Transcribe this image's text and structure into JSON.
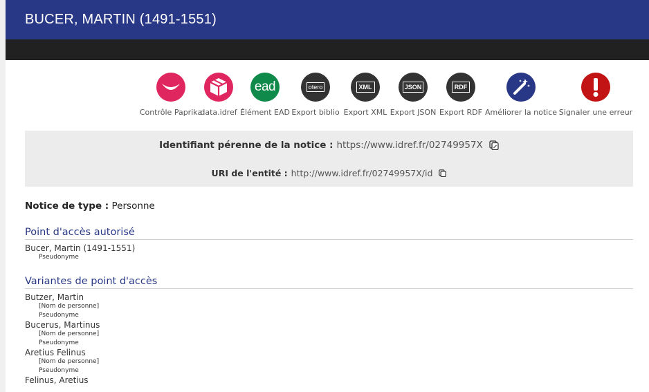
{
  "header": {
    "title": "BUCER, MARTIN (1491-1551)"
  },
  "colors": {
    "header_blue": "#293886",
    "dark_bar": "#212121",
    "section_blue": "#293886",
    "id_box_bg": "#ececec"
  },
  "actions": [
    {
      "label": "Contrôle Paprika",
      "icon": "paprika-icon",
      "color": "#e0265f"
    },
    {
      "label": "data.idref",
      "icon": "cube-icon",
      "color": "#e0265f"
    },
    {
      "label": "Élément EAD",
      "icon": "ead-icon",
      "color": "#0f8a4b",
      "icon_text": "ead"
    },
    {
      "label": "Export biblio",
      "icon": "zotero-icon",
      "color": "#333333",
      "icon_text": "otero"
    },
    {
      "label": "Export XML",
      "icon": "xml-export-icon",
      "color": "#333333",
      "icon_text": "XML"
    },
    {
      "label": "Export JSON",
      "icon": "json-export-icon",
      "color": "#333333",
      "icon_text": "JSON"
    },
    {
      "label": "Export RDF",
      "icon": "rdf-export-icon",
      "color": "#333333",
      "icon_text": "RDF"
    },
    {
      "label": "Améliorer la notice",
      "icon": "magic-wand-icon",
      "color": "#293886"
    },
    {
      "label": "Signaler une erreur",
      "icon": "alert-icon",
      "color": "#c21414"
    }
  ],
  "identifiers": {
    "perenne_label": "Identifiant pérenne de la notice :",
    "perenne_value": "https://www.idref.fr/02749957X",
    "uri_label": "URI de l'entité :",
    "uri_value": "http://www.idref.fr/02749957X/id"
  },
  "notice": {
    "type_label": "Notice de type :",
    "type_value": "Personne"
  },
  "authorized": {
    "title": "Point d'accès autorisé",
    "name": "Bucer, Martin (1491-1551)",
    "note": "Pseudonyme"
  },
  "variants": {
    "title": "Variantes de point d'accès",
    "items": [
      {
        "name": "Butzer, Martin",
        "kind": "[Nom de personne]",
        "note": "Pseudonyme"
      },
      {
        "name": "Bucerus, Martinus",
        "kind": "[Nom de personne]",
        "note": "Pseudonyme"
      },
      {
        "name": "Aretius Felinus",
        "kind": "[Nom de personne]",
        "note": "Pseudonyme"
      },
      {
        "name": "Felinus, Aretius"
      }
    ]
  }
}
